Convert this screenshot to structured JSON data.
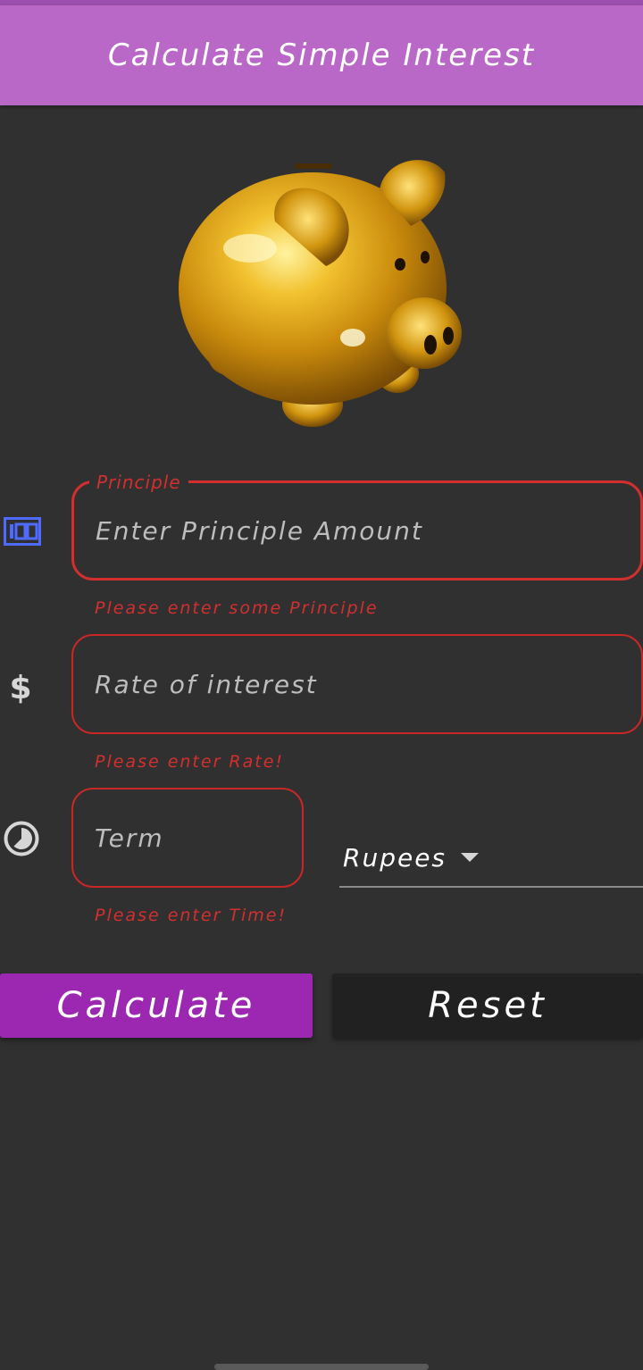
{
  "app_bar": {
    "title": "Calculate Simple Interest"
  },
  "principle": {
    "label": "Principle",
    "placeholder": "Enter Principle Amount",
    "error": "Please enter some  Principle"
  },
  "rate": {
    "placeholder": "Rate of interest",
    "error": "Please enter Rate!"
  },
  "term": {
    "placeholder": "Term",
    "error": "Please enter Time!"
  },
  "currency": {
    "selected": "Rupees"
  },
  "buttons": {
    "calculate": "Calculate",
    "reset": "Reset"
  },
  "colors": {
    "app_bar": "#ba68c8",
    "background": "#303030",
    "error": "#d32f2f",
    "calculate_button": "#9c27b0",
    "reset_button": "#212121"
  },
  "icons": {
    "principle": "hundred-icon",
    "rate": "dollar-icon",
    "term": "timelapse-icon",
    "dropdown": "caret-down-icon"
  }
}
